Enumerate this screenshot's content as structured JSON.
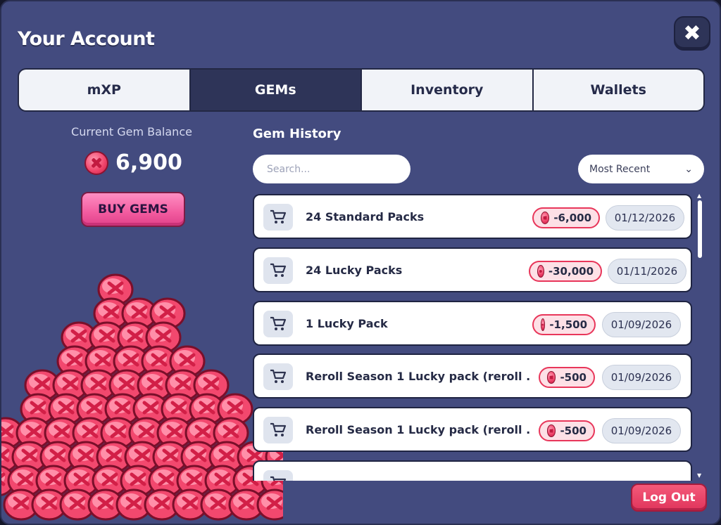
{
  "header": {
    "title": "Your Account",
    "close_icon": "close-icon"
  },
  "tabs": [
    {
      "label": "mXP",
      "active": false
    },
    {
      "label": "GEMs",
      "active": true
    },
    {
      "label": "Inventory",
      "active": false
    },
    {
      "label": "Wallets",
      "active": false
    }
  ],
  "balance": {
    "label": "Current Gem Balance",
    "value": "6,900",
    "icon": "gem-icon"
  },
  "buy_button": {
    "label": "BUY GEMS"
  },
  "history": {
    "title": "Gem History",
    "search_placeholder": "Search...",
    "sort_label": "Most Recent",
    "rows": [
      {
        "name": "24 Standard Packs",
        "amount": "-6,000",
        "date": "01/12/2026"
      },
      {
        "name": "24 Lucky Packs",
        "amount": "-30,000",
        "date": "01/11/2026"
      },
      {
        "name": "1 Lucky Pack",
        "amount": "-1,500",
        "date": "01/09/2026"
      },
      {
        "name": "Reroll Season 1 Lucky pack (reroll ...",
        "amount": "-500",
        "date": "01/09/2026"
      },
      {
        "name": "Reroll Season 1 Lucky pack (reroll ...",
        "amount": "-500",
        "date": "01/09/2026"
      }
    ]
  },
  "footer": {
    "logout_label": "Log Out"
  },
  "colors": {
    "panel": "#434b7f",
    "accent_pink": "#f25b9f",
    "gem_red": "#f2486e",
    "logout_red": "#e0345b"
  }
}
